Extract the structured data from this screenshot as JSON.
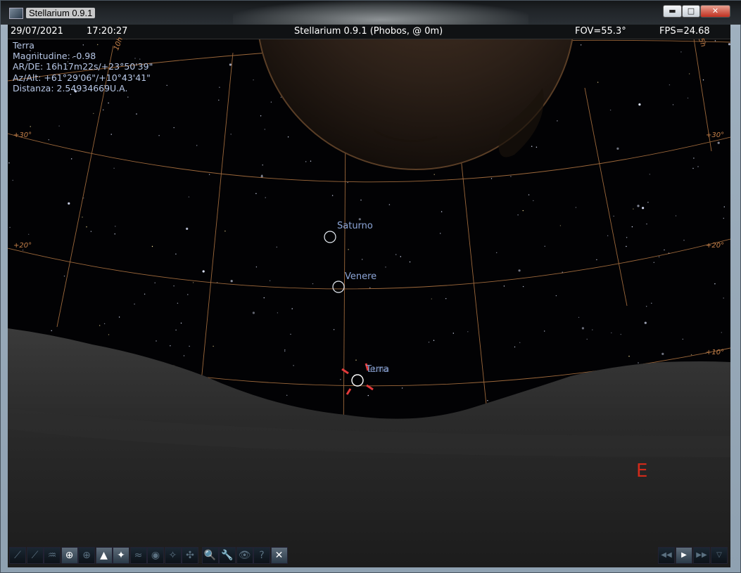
{
  "window": {
    "title": "Stellarium 0.9.1",
    "buttons": {
      "minimize": "▬",
      "maximize": "□",
      "close": "✕"
    }
  },
  "status": {
    "date": "29/07/2021",
    "time": "17:20:27",
    "location": "Stellarium 0.9.1 (Phobos,  @ 0m)",
    "fov": "FOV=55.3°",
    "fps": "FPS=24.68"
  },
  "object_info": {
    "name": "Terra",
    "magnitude": "Magnitudine: -0.98",
    "ra_de": "AR/DE: 16h17m22s/+23°50'39\"",
    "az_alt": "Az/Alt: +61°29'06\"/+10°43'41\"",
    "distance": "Distanza: 2.54934669U.A."
  },
  "sky_labels": {
    "saturn": "Saturno",
    "venus": "Venere",
    "earth_moon": "Terra",
    "moon": "Luna"
  },
  "grid_labels": {
    "p30_left": "+30°",
    "p30_right": "+30°",
    "p20_left": "+20°",
    "p20_right": "+20°",
    "p10_right": "+10°",
    "top_left": "10h",
    "top_right": "5h"
  },
  "cardinal": {
    "east": "E"
  },
  "toolbar": [
    {
      "name": "constellation-lines-button",
      "glyph": "⟋",
      "active": false
    },
    {
      "name": "constellation-names-button",
      "glyph": "⟋",
      "active": false
    },
    {
      "name": "constellation-art-button",
      "glyph": "♒",
      "active": false
    },
    {
      "name": "equatorial-grid-button",
      "glyph": "⊕",
      "active": true
    },
    {
      "name": "azimuthal-grid-button",
      "glyph": "⊕",
      "active": false
    },
    {
      "name": "ground-button",
      "glyph": "▲",
      "active": true
    },
    {
      "name": "cardinal-points-button",
      "glyph": "✦",
      "active": true
    },
    {
      "name": "atmosphere-button",
      "glyph": "≈",
      "active": false
    },
    {
      "name": "nebulae-button",
      "glyph": "◉",
      "active": false
    },
    {
      "name": "planet-hints-button",
      "glyph": "✧",
      "active": false
    },
    {
      "name": "equatorial-mount-button",
      "glyph": "✣",
      "active": false
    },
    {
      "name": "search-button",
      "glyph": "🔍",
      "active": false
    },
    {
      "name": "configuration-button",
      "glyph": "🔧",
      "active": false
    },
    {
      "name": "view-button",
      "glyph": "👁",
      "active": false
    },
    {
      "name": "help-button",
      "glyph": "?",
      "active": false
    },
    {
      "name": "quit-button",
      "glyph": "✕",
      "active": true
    }
  ],
  "timebar": [
    {
      "name": "rewind-button",
      "glyph": "◀◀"
    },
    {
      "name": "play-button",
      "glyph": "▶"
    },
    {
      "name": "fast-forward-button",
      "glyph": "▶▶"
    },
    {
      "name": "now-button",
      "glyph": "▽"
    }
  ],
  "colors": {
    "grid": "#b87a45",
    "label": "#8da6d8",
    "cardinal": "#d12a1a",
    "pointer": "#e23a3a"
  }
}
